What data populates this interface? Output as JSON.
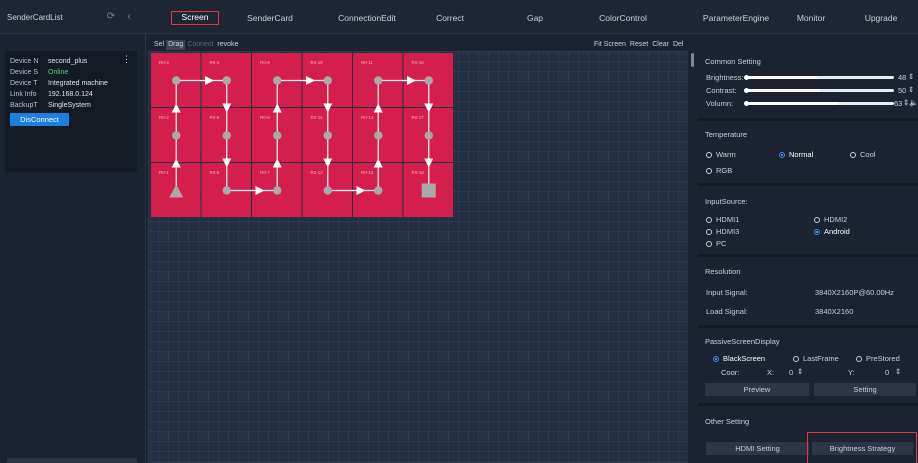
{
  "app": {
    "title": "SenderCardList"
  },
  "tabs": [
    {
      "label": "Screen",
      "active": true
    },
    {
      "label": "SenderCard"
    },
    {
      "label": "ConnectionEdit"
    },
    {
      "label": "Correct"
    },
    {
      "label": "Gap"
    },
    {
      "label": "ColorControl"
    },
    {
      "label": "ParameterEngine"
    },
    {
      "label": "Monitor"
    },
    {
      "label": "Upgrade"
    }
  ],
  "device": {
    "rows": [
      {
        "key": "Device N",
        "value": "second_plus"
      },
      {
        "key": "Device S",
        "value": "Online"
      },
      {
        "key": "Device T",
        "value": "Integrated machine"
      },
      {
        "key": "Link Info",
        "value": "192.168.0.124"
      },
      {
        "key": "BackupT",
        "value": "SingleSystem"
      }
    ],
    "disconnect": "DisConnect"
  },
  "toolbar": {
    "left": [
      "Sel",
      "Drag",
      "Connect",
      "revoke"
    ],
    "right": [
      "Fit Screen",
      "Reset",
      "Clear",
      "Del"
    ]
  },
  "grid": {
    "cols": 6,
    "rows": 3,
    "labels": [
      [
        "R0-3",
        "R0-4",
        "R0-9",
        "R0-10",
        "R0-11",
        "R0-16"
      ],
      [
        "R0-2",
        "R0-5",
        "R0-8",
        "R0-11",
        "R0-14",
        "R0-17"
      ],
      [
        "R0-1",
        "R0-6",
        "R0-7",
        "R0-12",
        "R0-13",
        "R0-18"
      ]
    ],
    "cell_color": "#d41e4e"
  },
  "common": {
    "title": "Common Setting",
    "sliders": [
      {
        "label": "Brightness:",
        "value": "48",
        "fraction": 0.48
      },
      {
        "label": "Contrast:",
        "value": "50",
        "fraction": 0.5
      },
      {
        "label": "Volumn:",
        "value": "63",
        "fraction": 0.63
      }
    ]
  },
  "temperature": {
    "title": "Temperature",
    "options": [
      "Warm",
      "Normal",
      "Cool",
      "RGB"
    ],
    "selected": "Normal"
  },
  "input": {
    "title": "InputSource:",
    "options": [
      "HDMI1",
      "HDMI2",
      "HDMI3",
      "Android",
      "PC"
    ],
    "selected": "Android"
  },
  "resolution": {
    "title": "Resolution",
    "input_label": "Input Signal:",
    "input_value": "3840X2160P@60.00Hz",
    "load_label": "Load Signal:",
    "load_value": "3840X2160"
  },
  "passive": {
    "title": "PassiveScreenDisplay",
    "options": [
      "BlackScreen",
      "LastFrame",
      "PreStored"
    ],
    "selected": "BlackScreen",
    "coor_label": "Coor:",
    "x_label": "X:",
    "x_value": "0",
    "y_label": "Y:",
    "y_value": "0",
    "preview": "Preview",
    "setting": "Setting"
  },
  "other": {
    "title": "Other Setting",
    "hdmi": "HDMI Setting",
    "brightness": "Brightness Strategy"
  },
  "colors": {
    "accent": "#1a7fe0",
    "highlight": "#e03a3a",
    "online": "#4fd18b",
    "panel": "#d41e4e"
  }
}
